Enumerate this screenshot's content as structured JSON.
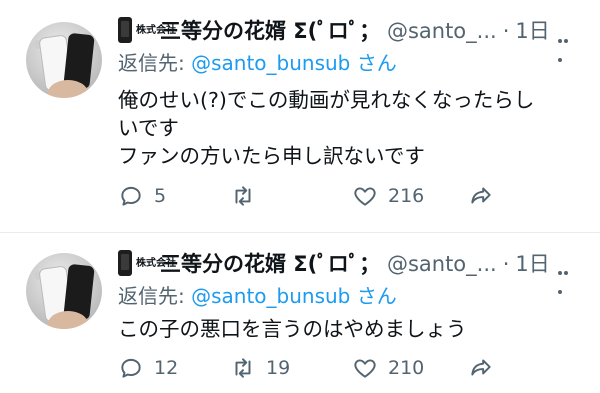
{
  "tweets": [
    {
      "author": {
        "kabu": "株式会社",
        "display_name": "三等分の花婿 Σ(ﾟロﾟ；",
        "handle": "@santo_..."
      },
      "time": "1日",
      "reply_label": "返信先:",
      "reply_handle": "@santo_bunsub",
      "reply_suffix": "さん",
      "text_lines": [
        "俺のせい(?)でこの動画が見れなくなったらし",
        "いです",
        "ファンの方いたら申し訳ないです"
      ],
      "replies": "5",
      "retweets": "",
      "likes": "216"
    },
    {
      "author": {
        "kabu": "株式会社",
        "display_name": "三等分の花婿 Σ(ﾟロﾟ；",
        "handle": "@santo_..."
      },
      "time": "1日",
      "reply_label": "返信先:",
      "reply_handle": "@santo_bunsub",
      "reply_suffix": "さん",
      "text_lines": [
        "この子の悪口を言うのはやめましょう"
      ],
      "replies": "12",
      "retweets": "19",
      "likes": "210"
    }
  ],
  "colors": {
    "link": "#1d9bf0",
    "secondary_text": "#536471",
    "primary_text": "#0f1419",
    "divider": "#e6ecf0"
  },
  "icons": [
    "phone-icon",
    "reply-icon",
    "retweet-icon",
    "like-icon",
    "share-icon",
    "more-icon"
  ]
}
